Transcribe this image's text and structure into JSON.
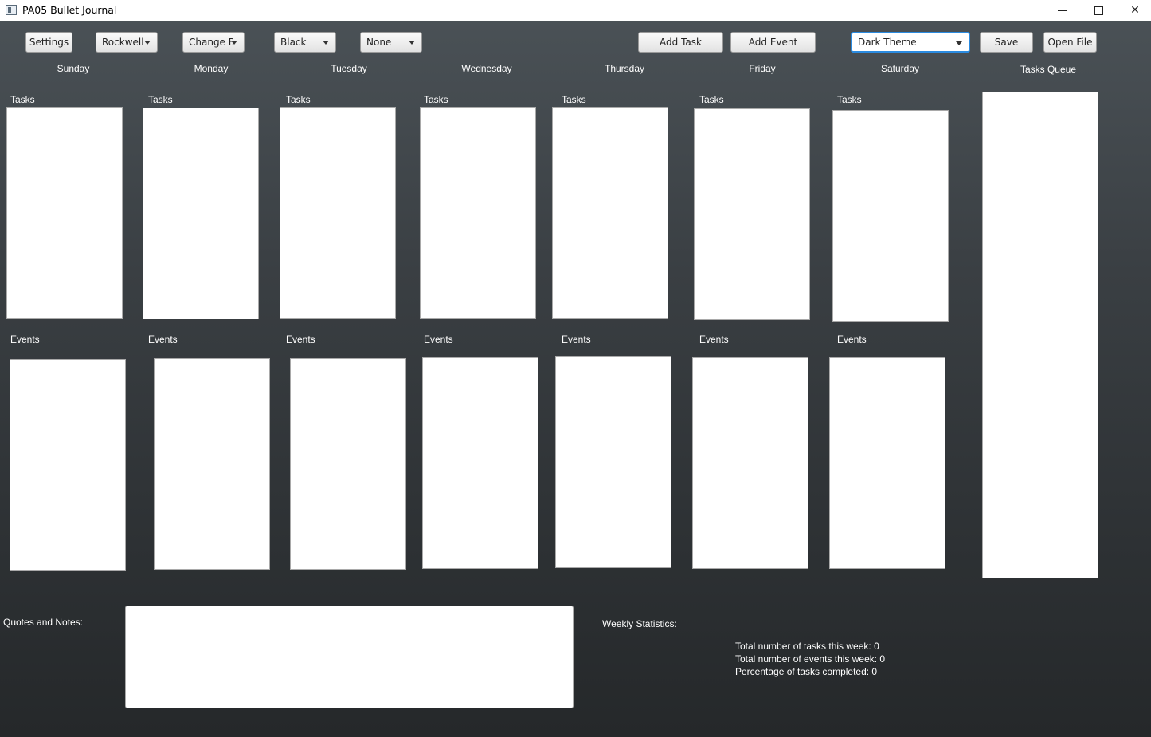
{
  "window": {
    "title": "PA05 Bullet Journal"
  },
  "toolbar": {
    "settings_label": "Settings",
    "font_value": "Rockwell",
    "change_label": "Change B...",
    "color_value": "Black",
    "none_value": "None",
    "add_task_label": "Add Task",
    "add_event_label": "Add Event",
    "theme_value": "Dark Theme",
    "save_label": "Save",
    "open_file_label": "Open File"
  },
  "days": [
    "Sunday",
    "Monday",
    "Tuesday",
    "Wednesday",
    "Thursday",
    "Friday",
    "Saturday"
  ],
  "sections": {
    "tasks_label": "Tasks",
    "events_label": "Events",
    "queue_label": "Tasks Queue"
  },
  "notes": {
    "label": "Quotes and Notes:",
    "value": ""
  },
  "stats": {
    "title": "Weekly Statistics:",
    "tasks": "Total number of tasks this week: 0",
    "events": "Total number of events this week: 0",
    "percentage": "Percentage of tasks completed: 0"
  }
}
